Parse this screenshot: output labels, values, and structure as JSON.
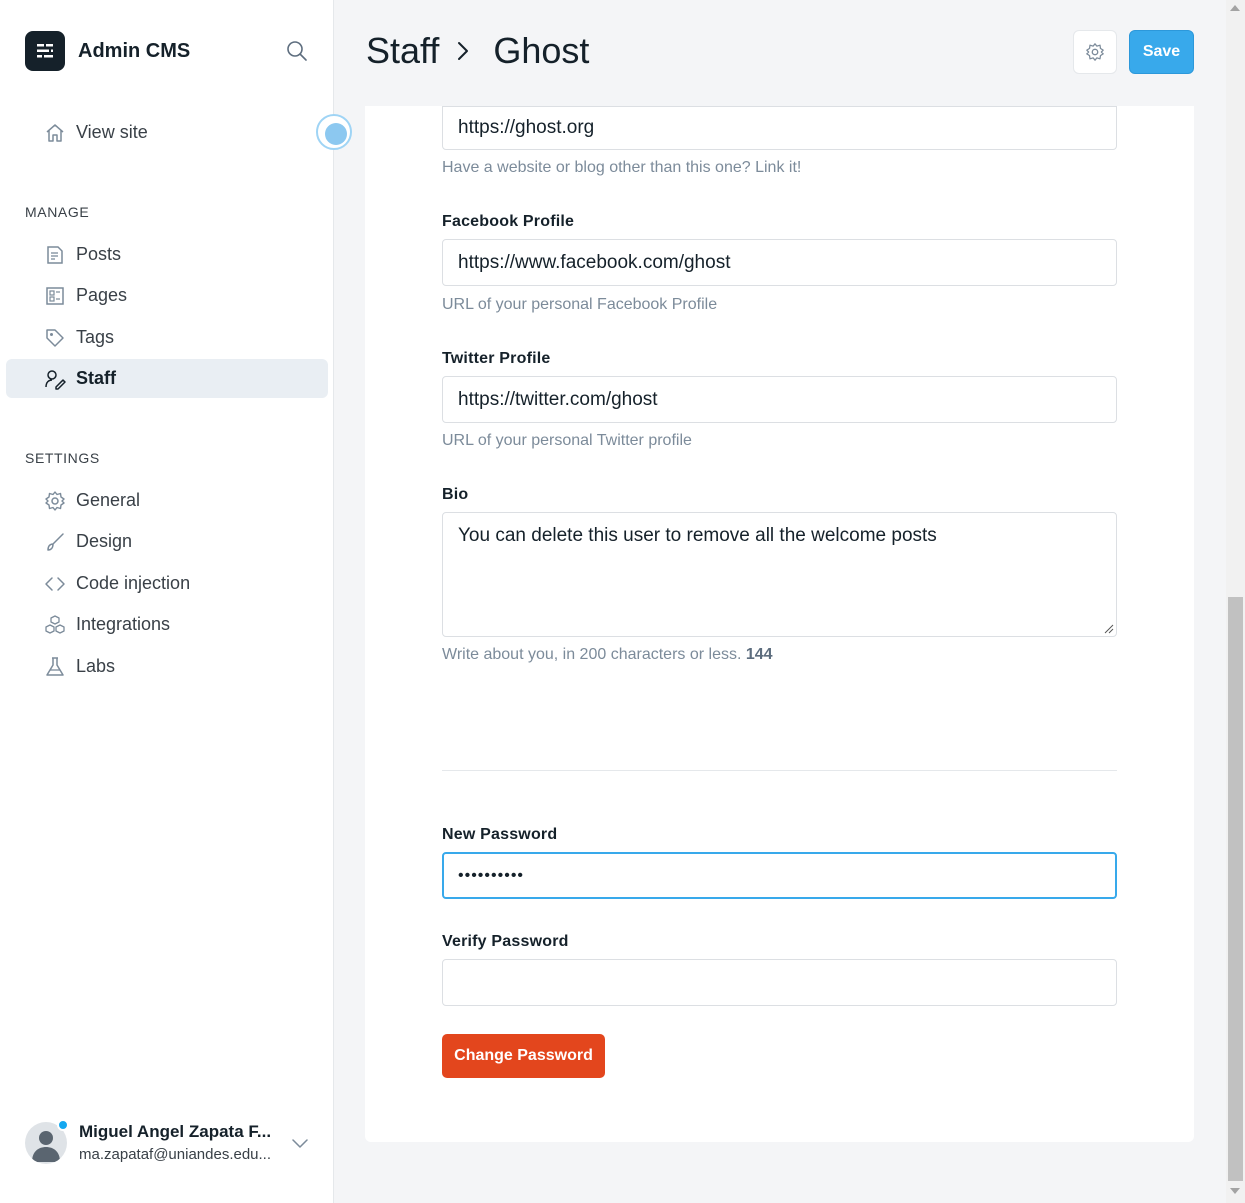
{
  "app": {
    "name": "Admin CMS"
  },
  "sidebar": {
    "view_site": "View site",
    "manage_label": "MANAGE",
    "manage_items": [
      {
        "label": "Posts",
        "icon": "posts-icon"
      },
      {
        "label": "Pages",
        "icon": "pages-icon"
      },
      {
        "label": "Tags",
        "icon": "tag-icon"
      },
      {
        "label": "Staff",
        "icon": "staff-icon",
        "active": true
      }
    ],
    "settings_label": "SETTINGS",
    "settings_items": [
      {
        "label": "General",
        "icon": "gear-icon"
      },
      {
        "label": "Design",
        "icon": "brush-icon"
      },
      {
        "label": "Code injection",
        "icon": "code-icon"
      },
      {
        "label": "Integrations",
        "icon": "integrations-icon"
      },
      {
        "label": "Labs",
        "icon": "flask-icon"
      }
    ],
    "user": {
      "name": "Miguel Angel Zapata F...",
      "email": "ma.zapataf@uniandes.edu..."
    }
  },
  "header": {
    "breadcrumb_parent": "Staff",
    "breadcrumb_current": "Ghost",
    "save_label": "Save"
  },
  "form": {
    "website": {
      "value": "https://ghost.org",
      "hint": "Have a website or blog other than this one? Link it!"
    },
    "facebook": {
      "label": "Facebook Profile",
      "value": "https://www.facebook.com/ghost",
      "hint": "URL of your personal Facebook Profile"
    },
    "twitter": {
      "label": "Twitter Profile",
      "value": "https://twitter.com/ghost",
      "hint": "URL of your personal Twitter profile"
    },
    "bio": {
      "label": "Bio",
      "value": "You can delete this user to remove all the welcome posts",
      "hint": "Write about you, in 200 characters or less.",
      "count": "144"
    },
    "new_password": {
      "label": "New Password",
      "value": "••••••••••"
    },
    "verify_password": {
      "label": "Verify Password",
      "value": ""
    },
    "change_password_label": "Change Password"
  },
  "colors": {
    "accent": "#38a9eb",
    "danger": "#e3461d",
    "dark": "#15212a"
  }
}
